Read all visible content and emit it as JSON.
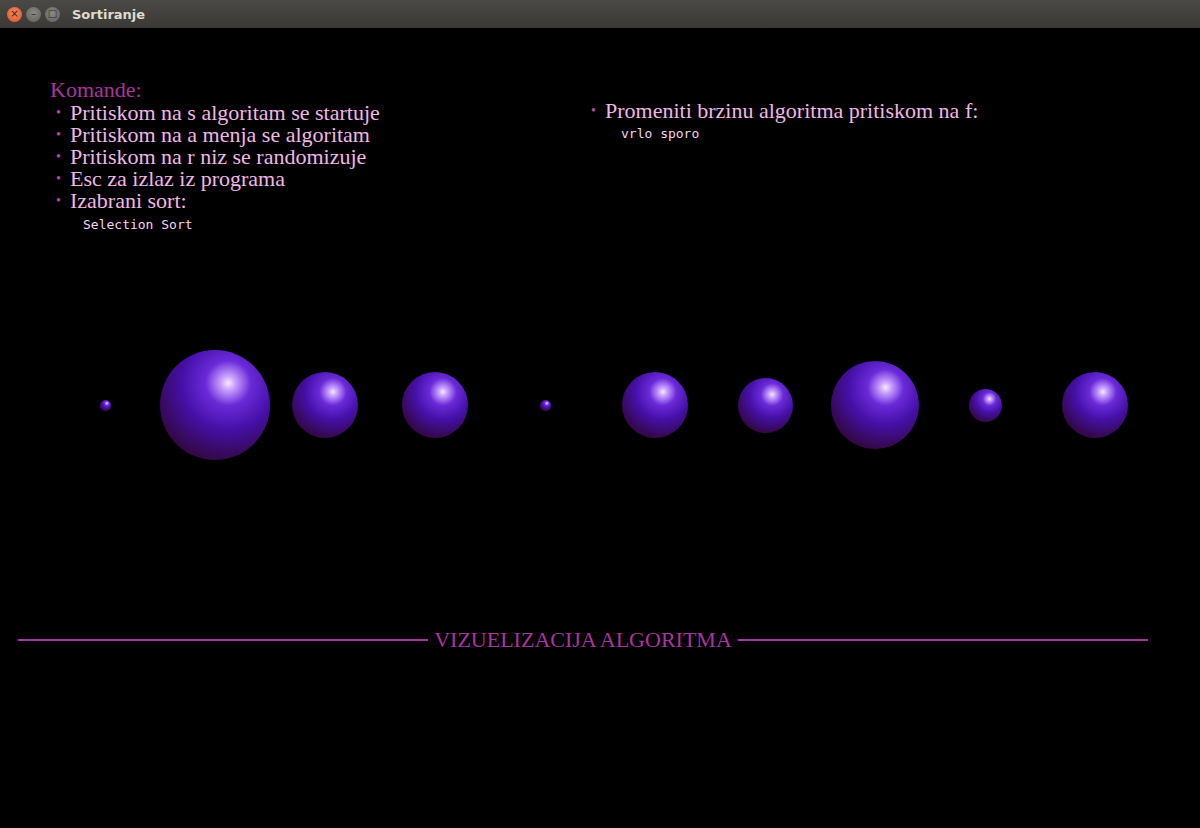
{
  "window": {
    "title": "Sortiranje",
    "buttons": [
      {
        "glyph": "×",
        "kind": "close"
      },
      {
        "glyph": "–",
        "kind": "minimize"
      },
      {
        "glyph": "□",
        "kind": "maximize"
      }
    ]
  },
  "commands": {
    "heading": "Komande:",
    "bullet": "•",
    "items": [
      "Pritiskom na s algoritam se startuje",
      "Pritiskom na a menja se algoritam",
      "Pritiskom na r niz se randomizuje",
      "Esc za izlaz iz programa",
      "Izabrani sort:"
    ],
    "selected_sort": "Selection Sort"
  },
  "speed": {
    "label": "Promeniti brzinu algoritma pritiskom na f:",
    "value": "vrlo sporo"
  },
  "chart": {
    "values": [
      1,
      10,
      6,
      6,
      1,
      6,
      5,
      8,
      3,
      6
    ]
  },
  "footer": {
    "title": "VIZUELIZACIJA ALGORITMA"
  }
}
